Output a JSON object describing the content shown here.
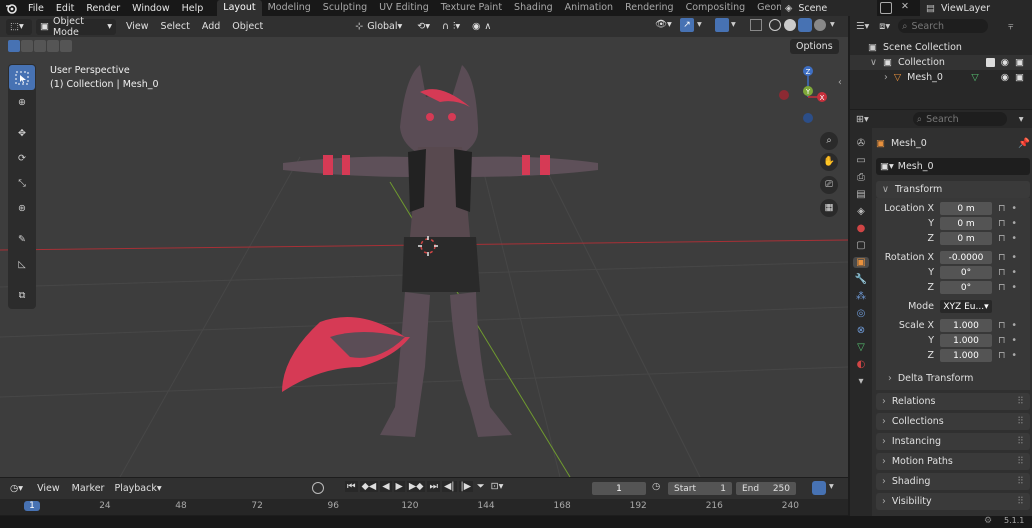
{
  "menu": {
    "file": "File",
    "edit": "Edit",
    "render": "Render",
    "window": "Window",
    "help": "Help"
  },
  "workspaces": [
    "Layout",
    "Modeling",
    "Sculpting",
    "UV Editing",
    "Texture Paint",
    "Shading",
    "Animation",
    "Rendering",
    "Compositing",
    "Geometry Nodes"
  ],
  "scene": "Scene",
  "view_layer": "ViewLayer",
  "header": {
    "mode": "Object Mode",
    "view": "View",
    "select": "Select",
    "add": "Add",
    "object": "Object",
    "orientation": "Global",
    "options": "Options"
  },
  "viewport": {
    "perspective": "User Perspective",
    "collection_info": "(1) Collection | Mesh_0"
  },
  "gizmo": {
    "x": "X",
    "y": "Y",
    "z": "Z"
  },
  "outliner": {
    "search_placeholder": "Search",
    "scene_collection": "Scene Collection",
    "collection": "Collection",
    "mesh": "Mesh_0"
  },
  "properties": {
    "search_placeholder": "Search",
    "object_name": "Mesh_0",
    "data_name": "Mesh_0",
    "transform": "Transform",
    "location_label": "Location X",
    "location": [
      "0 m",
      "0 m",
      "0 m"
    ],
    "rotation_label": "Rotation X",
    "rotation": [
      "-0.0000",
      "0°",
      "0°"
    ],
    "mode_label": "Mode",
    "mode": "XYZ Eu...",
    "scale_label": "Scale X",
    "scale": [
      "1.000",
      "1.000",
      "1.000"
    ],
    "y_label": "Y",
    "z_label": "Z",
    "delta": "Delta Transform",
    "panels": [
      "Relations",
      "Collections",
      "Instancing",
      "Motion Paths",
      "Shading",
      "Visibility"
    ]
  },
  "timeline": {
    "view": "View",
    "marker": "Marker",
    "playback": "Playback",
    "frame": "1",
    "start_label": "Start",
    "start": "1",
    "end_label": "End",
    "end": "250"
  },
  "ruler": [
    "1",
    "24",
    "48",
    "72",
    "96",
    "120",
    "144",
    "168",
    "192",
    "216",
    "240"
  ],
  "version": "5.1.1",
  "colors": {
    "accent": "#4772b3",
    "x_axis": "#c8303c",
    "y_axis": "#7ea839",
    "z_axis": "#3e6fc4"
  }
}
